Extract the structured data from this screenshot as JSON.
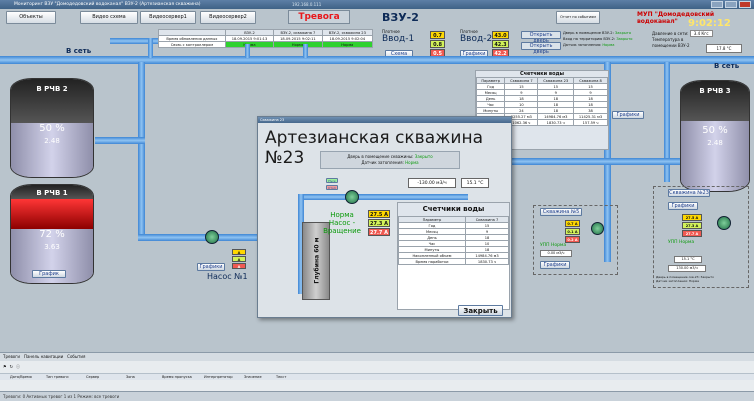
{
  "titlebar": {
    "text": "Мониторинг ВЗУ \"Домодедовский водоканал\" ВЗУ-2 (Артезианская скважина)",
    "center": "192.168.0.111"
  },
  "nav": {
    "objects": "Объекты",
    "video": "Видео схема",
    "video1": "Видеосервер1",
    "video2": "Видеосервер2",
    "alarm": "Тревога",
    "events": "Отчет по событиям"
  },
  "header": {
    "title": "ВЗУ-2",
    "org": "МУП \"Домодедовский водоканал\"",
    "clock": "9:02:12"
  },
  "status_table": {
    "headers": [
      "",
      "ВЗУ-2",
      "ВЗУ-2, скважина 7",
      "ВЗУ-2, скважина 23"
    ],
    "rows": [
      [
        "Время обновления данных",
        "18.09.2015 9:01:13",
        "18.09.2015 9:02:11",
        "18.09.2015 9:02:04"
      ],
      [
        "Связь с контроллером",
        "Норма",
        "Норма",
        "Норма"
      ]
    ]
  },
  "vvod1": {
    "label1": "Плотное",
    "label2": "Ввод-1",
    "a": [
      "0.7 A",
      "0.8 A",
      "0.5 A"
    ],
    "btn": "Схема"
  },
  "vvod2": {
    "label1": "Плотное",
    "label2": "Ввод-2",
    "a": [
      "43.0 A",
      "42.3 A",
      "42.2 A"
    ],
    "btn": "Графики"
  },
  "doors": {
    "open": "Открыть дверь",
    "open2": "Открыть дверь",
    "text1": "Дверь в помещение ВЗУ-2:",
    "val1": "Закрыто",
    "text2": "Вход на территорию ВЗУ-2:",
    "val2": "Закрыто",
    "text3": "Датчик затопления:",
    "val3": "Норма"
  },
  "pressure": {
    "label": "Давление в сети:",
    "value": "3.4 Кгс",
    "temp_label": "Температура в помещении ВЗУ-2",
    "temp": "17.8 °C"
  },
  "net": {
    "left": "В сеть",
    "right": "В сеть"
  },
  "tanks": {
    "rchv2": {
      "name": "В РЧВ 2",
      "pct": "50 %",
      "val": "2.48"
    },
    "rchv1": {
      "name": "В РЧВ 1",
      "pct": "72 %",
      "val": "3.63",
      "btn": "График"
    },
    "rchv3": {
      "name": "В РЧВ 3",
      "pct": "50 %",
      "val": "2.48"
    }
  },
  "counters_bg": {
    "title": "Счетчики воды",
    "headers": [
      "Параметр",
      "Скважина 7",
      "Скважина 23",
      "Скважина 8"
    ],
    "rows": [
      [
        "Год",
        "15",
        "15",
        "15"
      ],
      [
        "Месяц",
        "9",
        "9",
        "9"
      ],
      [
        "День",
        "18",
        "18",
        "18"
      ],
      [
        "Час",
        "10",
        "18",
        "18"
      ],
      [
        "Минуты",
        "24",
        "18",
        "38"
      ],
      [
        "",
        "5255.27 м3",
        "14984.76 м3",
        "11425.31 м3"
      ],
      [
        "",
        "1062.36 ч",
        "1830.73 ч",
        "157.59 ч"
      ]
    ],
    "btn": "Графики"
  },
  "pump1": {
    "name": "Насос №1",
    "btn": "Графики",
    "amps": [
      "A",
      "A",
      "A"
    ]
  },
  "well5": {
    "name": "Скважина №5",
    "amps": [
      "0.7 A",
      "0.1 A",
      "0.2 A"
    ],
    "state": "УПП Норма",
    "flow": "0.00 м3/ч",
    "btn": "Графики"
  },
  "well23r": {
    "name": "Скважина №23",
    "btn": "Графики",
    "amps": [
      "27.5 A",
      "27.3 A",
      "27.7 A"
    ],
    "state": "УПП Норма",
    "temp": "15.1 °C",
    "flow": "130.00 м3/ч",
    "door": "Дверь в помещение скв.23: Закрыто",
    "flood": "Датчик затопления: Норма"
  },
  "modal": {
    "title_bar": "Скважина 23",
    "title": "Артезианская скважина №23",
    "door_label": "Дверь в помещение скважины:",
    "door_val": "Закрыто",
    "flood_label": "Датчик затопления:",
    "flood_val": "Норма",
    "pump_btn1": "Пуск",
    "pump_btn2": "Стоп",
    "pressure": "-130.00 м3/ч",
    "temp": "15.1 °C",
    "amps": [
      "27.5 A",
      "27.3 A",
      "27.7 A"
    ],
    "state1": "Норма",
    "state2": "Насос - Вращение",
    "depth": "Глубина 60 м",
    "close": "Закрыть",
    "counters": {
      "title": "Счетчики воды",
      "headers": [
        "Параметр",
        "Скважина 7"
      ],
      "rows": [
        [
          "Год",
          "15"
        ],
        [
          "Месяц",
          "9"
        ],
        [
          "День",
          "18"
        ],
        [
          "Час",
          "10"
        ],
        [
          "Минуты",
          "18"
        ],
        [
          "Накопленный объем",
          "14984.76 м3"
        ],
        [
          "Время наработки",
          "1830.73 ч"
        ]
      ]
    }
  },
  "bottom": {
    "tabs": [
      "Тревоги",
      "Панель навигации",
      "События"
    ],
    "cols": [
      "Дата/Время",
      "Тип тревоги",
      "Сервер",
      "Зона",
      "Время пропуска",
      "Интерпретатор",
      "Значение",
      "Текст"
    ],
    "status": "Тревоги: 0   Активных тревог 1 из 1   Режим: все тревоги"
  },
  "colors": {
    "alarm": "#e8181c",
    "clock": "#ffe66a",
    "pipe": "#3e86d4"
  }
}
